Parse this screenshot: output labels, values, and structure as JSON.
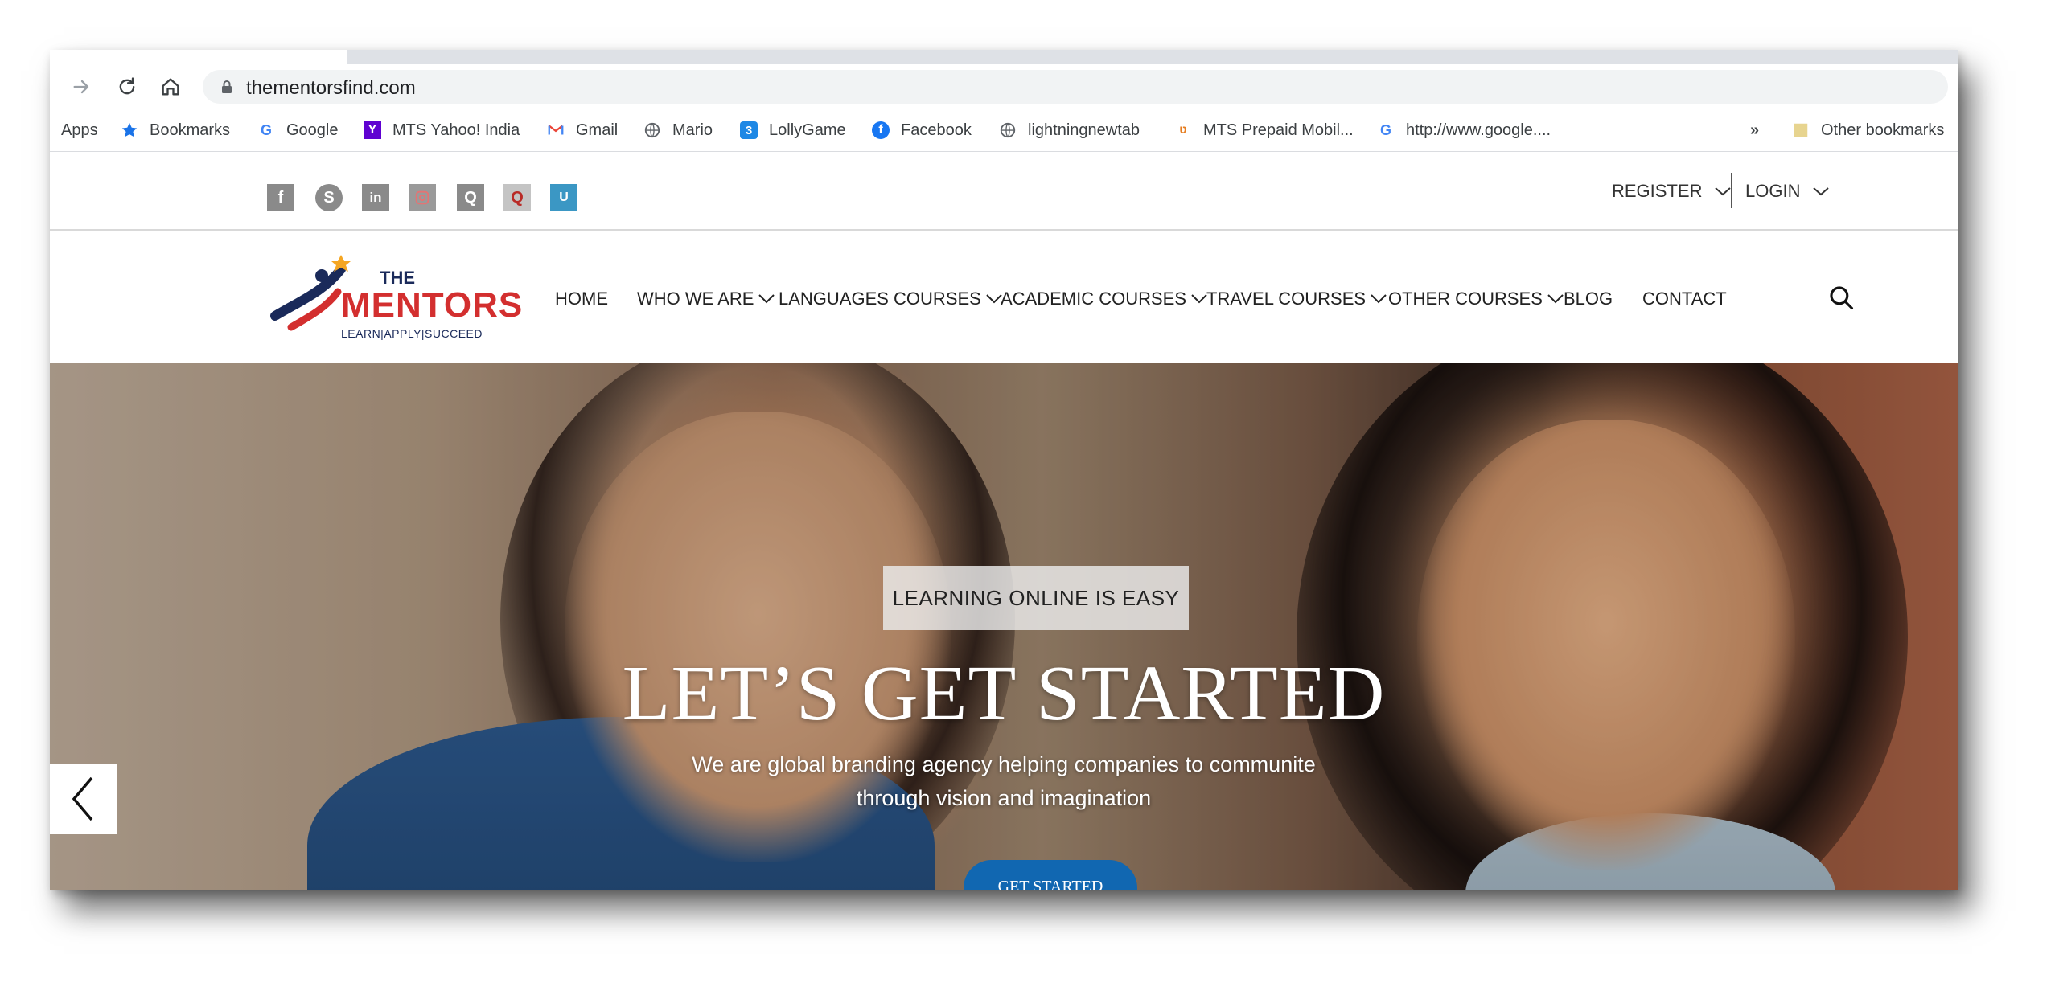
{
  "browser": {
    "url": "thementorsfind.com",
    "bookmarks": [
      {
        "label": "Apps",
        "icon": "apps-grid-icon"
      },
      {
        "label": "Bookmarks",
        "icon": "star-icon"
      },
      {
        "label": "Google",
        "icon": "google-icon"
      },
      {
        "label": "MTS Yahoo! India",
        "icon": "yahoo-icon"
      },
      {
        "label": "Gmail",
        "icon": "gmail-icon"
      },
      {
        "label": "Mario",
        "icon": "globe-icon"
      },
      {
        "label": "LollyGame",
        "icon": "lollygame-icon"
      },
      {
        "label": "Facebook",
        "icon": "facebook-icon"
      },
      {
        "label": "lightningnewtab",
        "icon": "globe-icon"
      },
      {
        "label": "MTS Prepaid Mobil...",
        "icon": "mts-icon"
      },
      {
        "label": "http://www.google....",
        "icon": "google-icon"
      }
    ],
    "overflow_label": "»",
    "other_bookmarks_label": "Other bookmarks"
  },
  "topbar": {
    "social_icons": [
      "facebook-icon",
      "skype-icon",
      "linkedin-icon",
      "instagram-icon",
      "quora-icon",
      "quora-red-icon",
      "urbanpro-icon"
    ],
    "register_label": "REGISTER",
    "login_label": "LOGIN"
  },
  "navbar": {
    "logo": {
      "line1": "THE",
      "line2": "MENTORS",
      "tagline": "LEARN|APPLY|SUCCEED"
    },
    "items": [
      {
        "label": "HOME",
        "dropdown": false
      },
      {
        "label": "WHO WE ARE",
        "dropdown": true
      },
      {
        "label": "LANGUAGES COURSES",
        "dropdown": true
      },
      {
        "label": "ACADEMIC COURSES",
        "dropdown": true
      },
      {
        "label": "TRAVEL COURSES",
        "dropdown": true
      },
      {
        "label": "OTHER COURSES",
        "dropdown": true
      },
      {
        "label": "BLOG",
        "dropdown": false
      },
      {
        "label": "CONTACT",
        "dropdown": false
      }
    ]
  },
  "hero": {
    "badge": "LEARNING ONLINE IS EASY",
    "title": "LET’S GET STARTED",
    "subtitle_line1": "We are global branding agency helping companies to communite",
    "subtitle_line2": "through vision and imagination",
    "cta_label": "GET STARTED"
  },
  "colors": {
    "accent_blue": "#1167b1",
    "logo_red": "#d32f2f",
    "logo_navy": "#1a2a5a"
  }
}
